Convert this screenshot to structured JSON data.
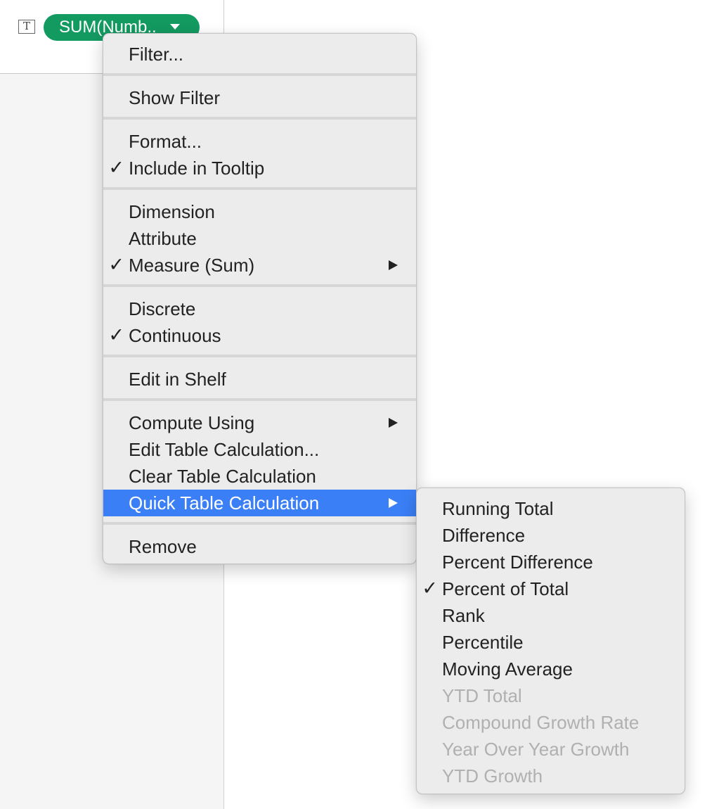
{
  "shelf": {
    "type_icon_glyph": "T",
    "pill_label": "SUM(Numb.."
  },
  "main_menu": {
    "items": [
      {
        "label": "Filter...",
        "checked": false,
        "submenu": false
      },
      {
        "label": "Show Filter",
        "checked": false,
        "submenu": false
      },
      {
        "label": "Format...",
        "checked": false,
        "submenu": false
      },
      {
        "label": "Include in Tooltip",
        "checked": true,
        "submenu": false
      },
      {
        "label": "Dimension",
        "checked": false,
        "submenu": false
      },
      {
        "label": "Attribute",
        "checked": false,
        "submenu": false
      },
      {
        "label": "Measure (Sum)",
        "checked": true,
        "submenu": true
      },
      {
        "label": "Discrete",
        "checked": false,
        "submenu": false
      },
      {
        "label": "Continuous",
        "checked": true,
        "submenu": false
      },
      {
        "label": "Edit in Shelf",
        "checked": false,
        "submenu": false
      },
      {
        "label": "Compute Using",
        "checked": false,
        "submenu": true
      },
      {
        "label": "Edit Table Calculation...",
        "checked": false,
        "submenu": false
      },
      {
        "label": "Clear Table Calculation",
        "checked": false,
        "submenu": false
      },
      {
        "label": "Quick Table Calculation",
        "checked": false,
        "submenu": true,
        "highlighted": true
      },
      {
        "label": "Remove",
        "checked": false,
        "submenu": false
      }
    ]
  },
  "sub_menu": {
    "items": [
      {
        "label": "Running Total",
        "checked": false,
        "enabled": true
      },
      {
        "label": "Difference",
        "checked": false,
        "enabled": true
      },
      {
        "label": "Percent Difference",
        "checked": false,
        "enabled": true
      },
      {
        "label": "Percent of Total",
        "checked": true,
        "enabled": true
      },
      {
        "label": "Rank",
        "checked": false,
        "enabled": true
      },
      {
        "label": "Percentile",
        "checked": false,
        "enabled": true
      },
      {
        "label": "Moving Average",
        "checked": false,
        "enabled": true
      },
      {
        "label": "YTD Total",
        "checked": false,
        "enabled": false
      },
      {
        "label": "Compound Growth Rate",
        "checked": false,
        "enabled": false
      },
      {
        "label": "Year Over Year Growth",
        "checked": false,
        "enabled": false
      },
      {
        "label": "YTD Growth",
        "checked": false,
        "enabled": false
      }
    ]
  },
  "glyphs": {
    "check": "✓"
  },
  "colors": {
    "pill_green": "#139a61",
    "highlight_blue": "#3a7ff6",
    "disabled_text": "#b0b0b0"
  }
}
